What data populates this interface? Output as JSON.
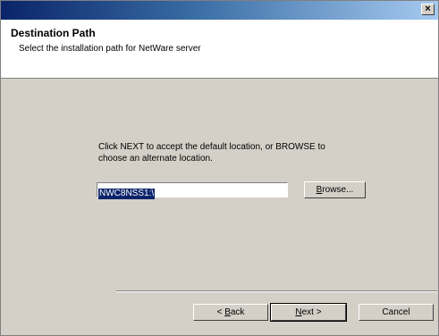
{
  "dialog": {
    "close_glyph": "×",
    "header": {
      "title": "Destination Path",
      "subtitle": "Select the installation path for NetWare server"
    },
    "instruction_line1": "Click NEXT to accept the default location, or BROWSE to",
    "instruction_line2": "choose an alternate location.",
    "path_value": "NWC8NSS1:\\",
    "browse": {
      "pre": "",
      "accel": "B",
      "post": "rowse..."
    },
    "back": {
      "pre": "< ",
      "accel": "B",
      "post": "ack"
    },
    "next": {
      "pre": "",
      "accel": "N",
      "post": "ext >"
    },
    "cancel_label": "Cancel"
  }
}
